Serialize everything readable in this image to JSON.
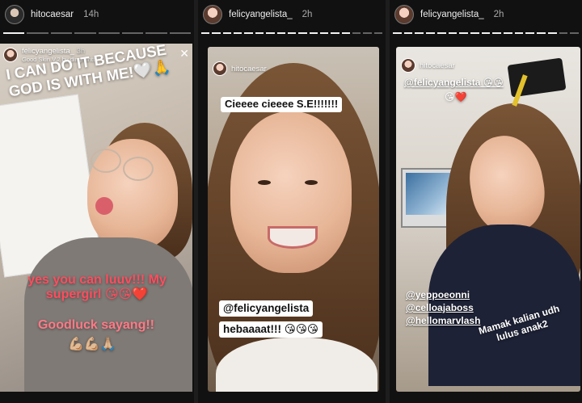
{
  "panels": [
    {
      "username": "hitocaesar",
      "time": "14h",
      "story": {
        "poster": "felicyangelista_",
        "poster_time": "3h",
        "filter": "Good Skin V.2 by dingmintt",
        "headline": "I CAN DO IT BECAUSE GOD IS WITH ME!🤍🙏",
        "caption_main": "yes you can luuv!!! My supergirl 😘😘❤️",
        "caption_sub": "Goodluck sayang!!",
        "caption_emoji": "💪🏼💪🏼🙏🏼",
        "close_icon": "✕"
      }
    },
    {
      "username": "felicyangelista_",
      "time": "2h",
      "story": {
        "poster": "hitocaesar",
        "headline": "Cieeee cieeee S.E!!!!!!!",
        "mention": "@felicyangelista",
        "caption": "hebaaaat!!! 😘😘😘"
      }
    },
    {
      "username": "felicyangelista_",
      "time": "2h",
      "story": {
        "poster": "hitocaesar",
        "mention_top": "@felicyangelista 😘😘",
        "mention_top_emoji": "😘❤️",
        "tags": [
          "@yeppoeonni",
          "@celloajaboss",
          "@hellomarvlash"
        ],
        "tilted": "Mamak kalian udh lulus anak2"
      }
    }
  ],
  "colors": {
    "accent_red": "#ff4d5e",
    "accent_pink": "#ff7a86"
  }
}
